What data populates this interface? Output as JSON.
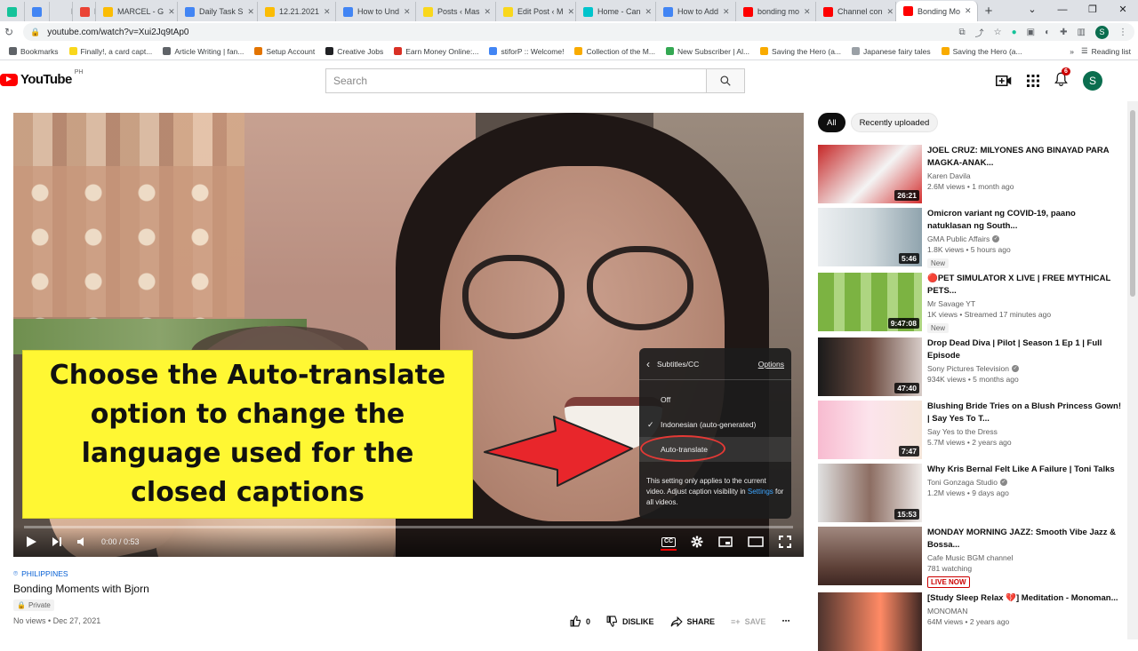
{
  "browser": {
    "tabs": [
      {
        "label": "",
        "color": "#15c39a"
      },
      {
        "label": "",
        "color": "#4285f4"
      },
      {
        "label": "HI",
        "color": ""
      },
      {
        "label": "M",
        "color": "#ea4335"
      },
      {
        "label": "MARCEL - G",
        "color": "#fbbc04"
      },
      {
        "label": "Daily Task S",
        "color": "#4285f4"
      },
      {
        "label": "12.21.2021",
        "color": "#fbbc04"
      },
      {
        "label": "How to Und",
        "color": "#4285f4"
      },
      {
        "label": "Posts ‹ Mas",
        "color": "#f9d71c"
      },
      {
        "label": "Edit Post ‹ M",
        "color": "#f9d71c"
      },
      {
        "label": "Home - Can",
        "color": "#00c4cc"
      },
      {
        "label": "How to Add",
        "color": "#4285f4"
      },
      {
        "label": "bonding mo",
        "color": "#ff0000"
      },
      {
        "label": "Channel con",
        "color": "#ff0000"
      },
      {
        "label": "Bonding Mo",
        "color": "#ff0000",
        "active": true
      }
    ],
    "url": "youtube.com/watch?v=Xui2Jq9tAp0",
    "bookmarks": [
      {
        "label": "Bookmarks",
        "color": "#5f6368"
      },
      {
        "label": "Finally!, a card capt...",
        "color": "#f9d71c"
      },
      {
        "label": "Article Writing | fan...",
        "color": "#5f6368"
      },
      {
        "label": "Setup Account",
        "color": "#e37400"
      },
      {
        "label": "Creative Jobs",
        "color": "#202124"
      },
      {
        "label": "Earn Money Online:...",
        "color": "#d93025"
      },
      {
        "label": "stiforP :: Welcome!",
        "color": "#4285f4"
      },
      {
        "label": "Collection of the M...",
        "color": "#f9ab00"
      },
      {
        "label": "New Subscriber | Al...",
        "color": "#34a853"
      },
      {
        "label": "Saving the Hero (a...",
        "color": "#f9ab00"
      },
      {
        "label": "Japanese fairy tales",
        "color": "#9aa0a6"
      },
      {
        "label": "Saving the Hero (a...",
        "color": "#f9ab00"
      }
    ],
    "more_label": "»",
    "reading_list": "Reading list",
    "profile_initial": "S"
  },
  "youtube": {
    "logo_text": "YouTube",
    "country_code": "PH",
    "search_placeholder": "Search",
    "notification_count": "6",
    "avatar_initial": "S"
  },
  "player": {
    "callout_text": "Choose the Auto-translate option to change the language used for the closed captions",
    "time": "0:00 / 0:53",
    "captions_menu": {
      "title": "Subtitles/CC",
      "options_label": "Options",
      "items": [
        {
          "label": "Off",
          "checked": false
        },
        {
          "label": "Indonesian (auto-generated)",
          "checked": true
        },
        {
          "label": "Auto-translate",
          "checked": false
        }
      ],
      "note_text": "This setting only applies to the current video. Adjust caption visibility in",
      "note_link": "Settings",
      "note_tail": "for all videos."
    }
  },
  "video": {
    "location": "PHILIPPINES",
    "title": "Bonding Moments with Bjorn",
    "visibility": "Private",
    "meta": "No views • Dec 27, 2021",
    "likes": "0",
    "dislike_label": "DISLIKE",
    "share_label": "SHARE",
    "save_label": "SAVE"
  },
  "sidebar": {
    "chips": [
      {
        "label": "All",
        "active": true
      },
      {
        "label": "Recently uploaded",
        "active": false
      }
    ],
    "recommendations": [
      {
        "title": "JOEL CRUZ: MILYONES ANG BINAYAD PARA MAGKA-ANAK...",
        "channel": "Karen Davila",
        "verified": false,
        "views": "2.6M views • 1 month ago",
        "duration": "26:21",
        "badge": ""
      },
      {
        "title": "Omicron variant ng COVID-19, paano natuklasan ng South...",
        "channel": "GMA Public Affairs",
        "verified": true,
        "views": "1.8K views • 5 hours ago",
        "duration": "5:46",
        "badge": "New"
      },
      {
        "title": "🔴PET SIMULATOR X LIVE | FREE MYTHICAL PETS...",
        "channel": "Mr Savage YT",
        "verified": false,
        "views": "1K views • Streamed 17 minutes ago",
        "duration": "9:47:08",
        "badge": "New"
      },
      {
        "title": "Drop Dead Diva | Pilot | Season 1 Ep 1 | Full Episode",
        "channel": "Sony Pictures Television",
        "verified": true,
        "views": "934K views • 5 months ago",
        "duration": "47:40",
        "badge": ""
      },
      {
        "title": "Blushing Bride Tries on a Blush Princess Gown! | Say Yes To T...",
        "channel": "Say Yes to the Dress",
        "verified": false,
        "views": "5.7M views • 2 years ago",
        "duration": "7:47",
        "badge": ""
      },
      {
        "title": "Why Kris Bernal Felt Like A Failure | Toni Talks",
        "channel": "Toni Gonzaga Studio",
        "verified": true,
        "views": "1.2M views • 9 days ago",
        "duration": "15:53",
        "badge": ""
      },
      {
        "title": "MONDAY MORNING JAZZ: Smooth Vibe Jazz & Bossa...",
        "channel": "Cafe Music BGM channel",
        "verified": false,
        "views": "781 watching",
        "duration": "",
        "badge": "LIVE NOW"
      },
      {
        "title": "[Study Sleep Relax 💔] Meditation - Monoman...",
        "channel": "MONOMAN",
        "verified": false,
        "views": "64M views • 2 years ago",
        "duration": "",
        "badge": ""
      }
    ]
  }
}
